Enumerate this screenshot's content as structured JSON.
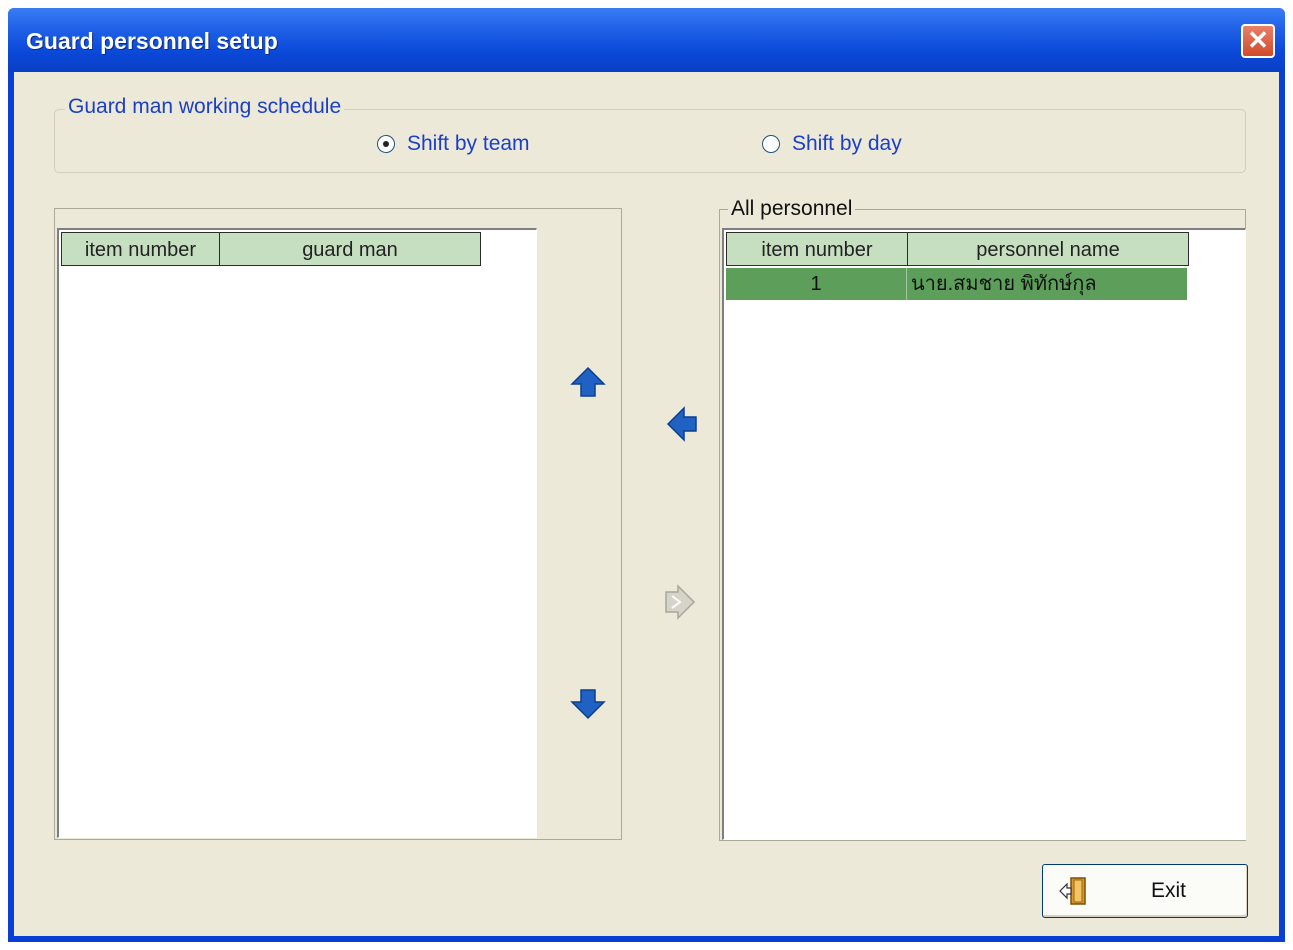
{
  "window": {
    "title": "Guard personnel setup"
  },
  "schedule_group": {
    "label": "Guard man working schedule",
    "options": [
      {
        "label": "Shift by team",
        "checked": true
      },
      {
        "label": "Shift by day",
        "checked": false
      }
    ]
  },
  "guard_grid": {
    "columns": [
      "item number",
      "guard man"
    ],
    "rows": []
  },
  "personnel_group": {
    "label": "All personnel",
    "columns": [
      "item number",
      "personnel name"
    ],
    "rows": [
      {
        "item_number": "1",
        "name": "นาย.สมชาย พิทักษ์กุล"
      }
    ]
  },
  "buttons": {
    "move_up": "arrow-up-icon",
    "move_down": "arrow-down-icon",
    "add_left": "arrow-left-icon",
    "remove_right": "arrow-right-icon",
    "exit_label": "Exit"
  },
  "colors": {
    "header_bg": "#c7dfc1",
    "selected_row": "#5c9e5a",
    "label_blue": "#1b3fc7",
    "arrow_blue": "#1f62c4"
  }
}
